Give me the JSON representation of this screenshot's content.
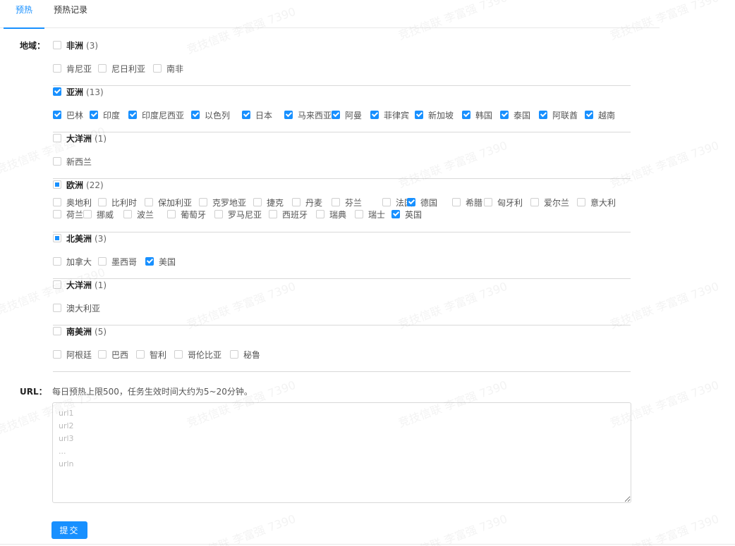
{
  "tabs": [
    {
      "label": "预热"
    },
    {
      "label": "预热记录"
    }
  ],
  "region_label": "地域：",
  "regions": [
    {
      "name": "非洲",
      "count": "(3)",
      "state": "none",
      "countries": [
        {
          "name": "肯尼亚",
          "checked": false
        },
        {
          "name": "尼日利亚",
          "checked": false
        },
        {
          "name": "南非",
          "checked": false
        }
      ]
    },
    {
      "name": "亚洲",
      "count": "(13)",
      "state": "all",
      "countries": [
        {
          "name": "巴林",
          "checked": true
        },
        {
          "name": "印度",
          "checked": true
        },
        {
          "name": "印度尼西亚",
          "checked": true
        },
        {
          "name": "以色列",
          "checked": true
        },
        {
          "name": "日本",
          "checked": true
        },
        {
          "name": "马来西亚",
          "checked": true
        },
        {
          "name": "阿曼",
          "checked": true
        },
        {
          "name": "菲律宾",
          "checked": true
        },
        {
          "name": "新加坡",
          "checked": true
        },
        {
          "name": "韩国",
          "checked": true
        },
        {
          "name": "泰国",
          "checked": true
        },
        {
          "name": "阿联酋",
          "checked": true
        },
        {
          "name": "越南",
          "checked": true
        }
      ]
    },
    {
      "name": "大洋洲",
      "count": "(1)",
      "state": "none",
      "countries": [
        {
          "name": "新西兰",
          "checked": false
        }
      ]
    },
    {
      "name": "欧洲",
      "count": "(22)",
      "state": "some",
      "countries": [
        {
          "name": "奥地利",
          "checked": false
        },
        {
          "name": "比利时",
          "checked": false
        },
        {
          "name": "保加利亚",
          "checked": false
        },
        {
          "name": "克罗地亚",
          "checked": false
        },
        {
          "name": "捷克",
          "checked": false
        },
        {
          "name": "丹麦",
          "checked": false
        },
        {
          "name": "芬兰",
          "checked": false
        },
        {
          "name": "法国",
          "checked": false
        },
        {
          "name": "德国",
          "checked": true
        },
        {
          "name": "希腊",
          "checked": false
        },
        {
          "name": "匈牙利",
          "checked": false
        },
        {
          "name": "爱尔兰",
          "checked": false
        },
        {
          "name": "意大利",
          "checked": false
        },
        {
          "name": "荷兰",
          "checked": false
        },
        {
          "name": "挪威",
          "checked": false
        },
        {
          "name": "波兰",
          "checked": false
        },
        {
          "name": "葡萄牙",
          "checked": false
        },
        {
          "name": "罗马尼亚",
          "checked": false
        },
        {
          "name": "西班牙",
          "checked": false
        },
        {
          "name": "瑞典",
          "checked": false
        },
        {
          "name": "瑞士",
          "checked": false
        },
        {
          "name": "英国",
          "checked": true
        }
      ]
    },
    {
      "name": "北美洲",
      "count": "(3)",
      "state": "some",
      "countries": [
        {
          "name": "加拿大",
          "checked": false
        },
        {
          "name": "墨西哥",
          "checked": false
        },
        {
          "name": "美国",
          "checked": true
        }
      ]
    },
    {
      "name": "大洋洲",
      "count": "(1)",
      "state": "none",
      "countries": [
        {
          "name": "澳大利亚",
          "checked": false
        }
      ]
    },
    {
      "name": "南美洲",
      "count": "(5)",
      "state": "none",
      "countries": [
        {
          "name": "阿根廷",
          "checked": false
        },
        {
          "name": "巴西",
          "checked": false
        },
        {
          "name": "智利",
          "checked": false
        },
        {
          "name": "哥伦比亚",
          "checked": false
        },
        {
          "name": "秘鲁",
          "checked": false
        }
      ]
    }
  ],
  "url_label": "URL：",
  "url_hint": "每日预热上限500，任务生效时间大约为5~20分钟。",
  "url_placeholder": "url1\nurl2\nurl3\n...\nurln",
  "submit_label": "提交",
  "watermark": "竞技信联 李富强 7390",
  "colors": {
    "primary": "#1890ff"
  }
}
